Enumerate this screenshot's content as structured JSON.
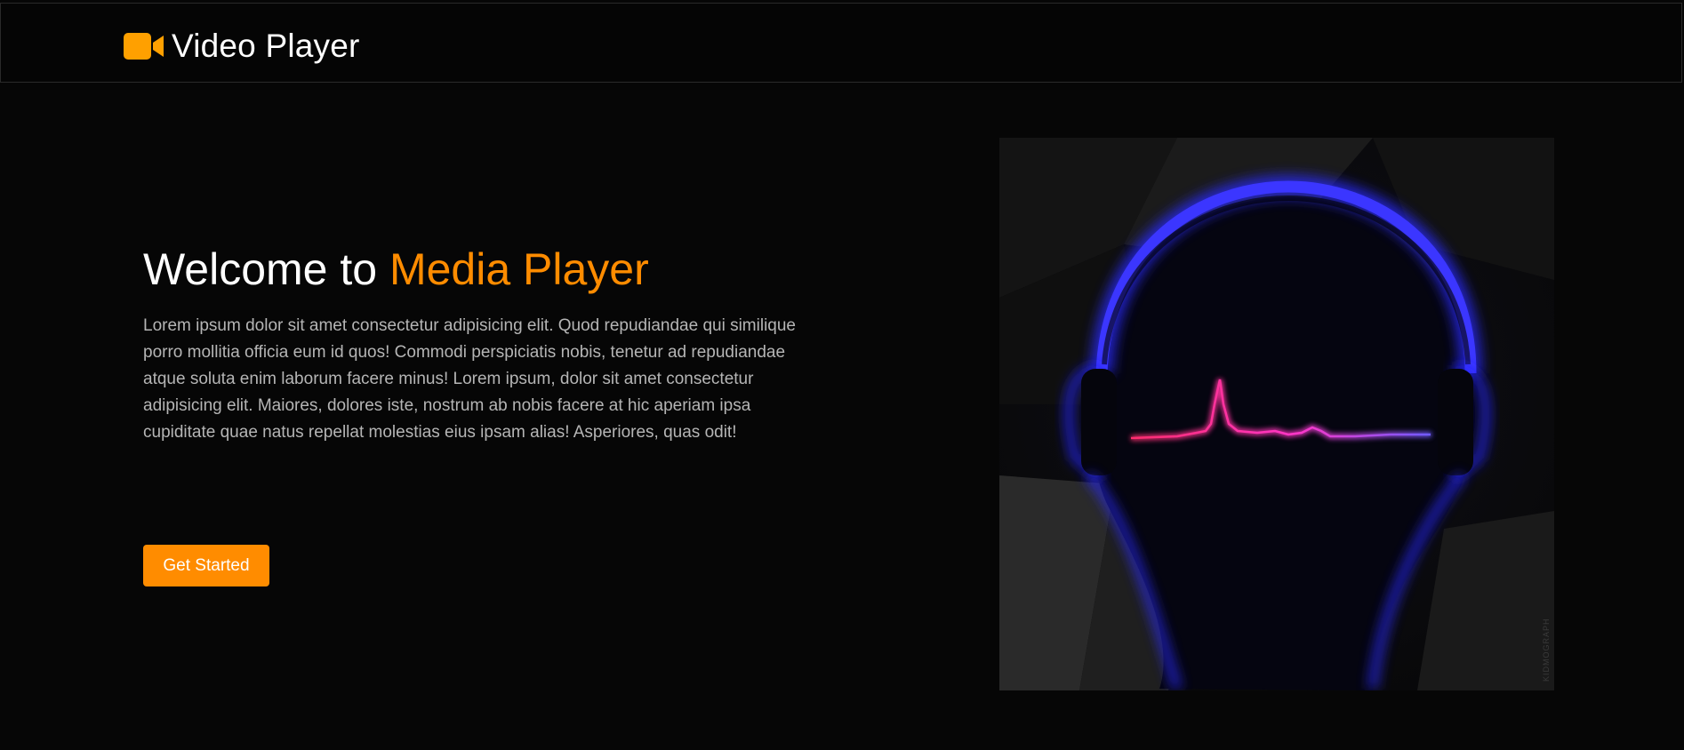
{
  "navbar": {
    "brand_icon": "video-camera-icon",
    "brand_label": "Video Player"
  },
  "hero": {
    "title_prefix": "Welcome to ",
    "title_accent": "Media Player",
    "description": "Lorem ipsum dolor sit amet consectetur adipisicing elit. Quod repudiandae qui similique porro mollitia officia eum id quos! Commodi perspiciatis nobis, tenetur ad repudiandae atque soluta enim laborum facere minus! Lorem ipsum, dolor sit amet consectetur adipisicing elit. Maiores, dolores iste, nostrum ab nobis facere at hic aperiam ipsa cupiditate quae natus repellat molestias eius ipsam alias! Asperiores, quas odit!",
    "cta_label": "Get Started",
    "image_watermark": "KIDMOGRAPH"
  },
  "colors": {
    "accent": "#ff8c00",
    "background": "#060606",
    "text": "#ffffff",
    "muted_text": "#b5b5b5",
    "glow_blue": "#2a2bff",
    "pulse_pink": "#ff2d8a"
  }
}
